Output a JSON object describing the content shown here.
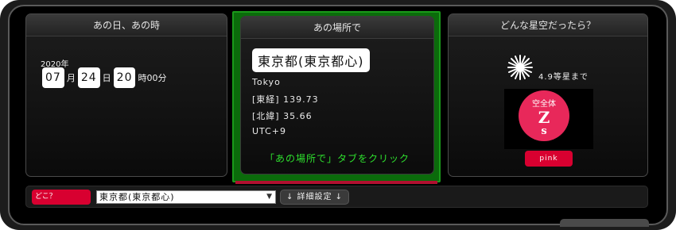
{
  "panel_when": {
    "title": "あの日、あの時",
    "year": "2020年",
    "month": "07",
    "month_unit": "月",
    "day": "24",
    "day_unit": "日",
    "hour": "20",
    "hour_unit": "時00分"
  },
  "panel_where": {
    "title": "あの場所で",
    "city": "東京都(東京都心)",
    "city_en": "Tokyo",
    "longitude": "[東経] 139.73",
    "latitude": "[北緯] 35.66",
    "timezone": "UTC+9",
    "hint": "「あの場所で」タブをクリック"
  },
  "panel_sky": {
    "title": "どんな星空だったら？",
    "magnitude": "4.9等星まで",
    "circle_line1": "空全体",
    "circle_line2": "Z",
    "circle_line3": "s",
    "color_label": "pink",
    "colors": {
      "accent": "#d80030",
      "circle": "#e8285a"
    },
    "icons": [
      "sparkle-icon"
    ]
  },
  "bottom_bar": {
    "where_label": "どこ？",
    "location_select": "東京都(東京都心)",
    "select_arrow": "▼",
    "detail_button": "↓ 詳細設定 ↓"
  },
  "colors": {
    "hint_green": "#2ee02e",
    "frame_green": "#0b6b0b"
  }
}
